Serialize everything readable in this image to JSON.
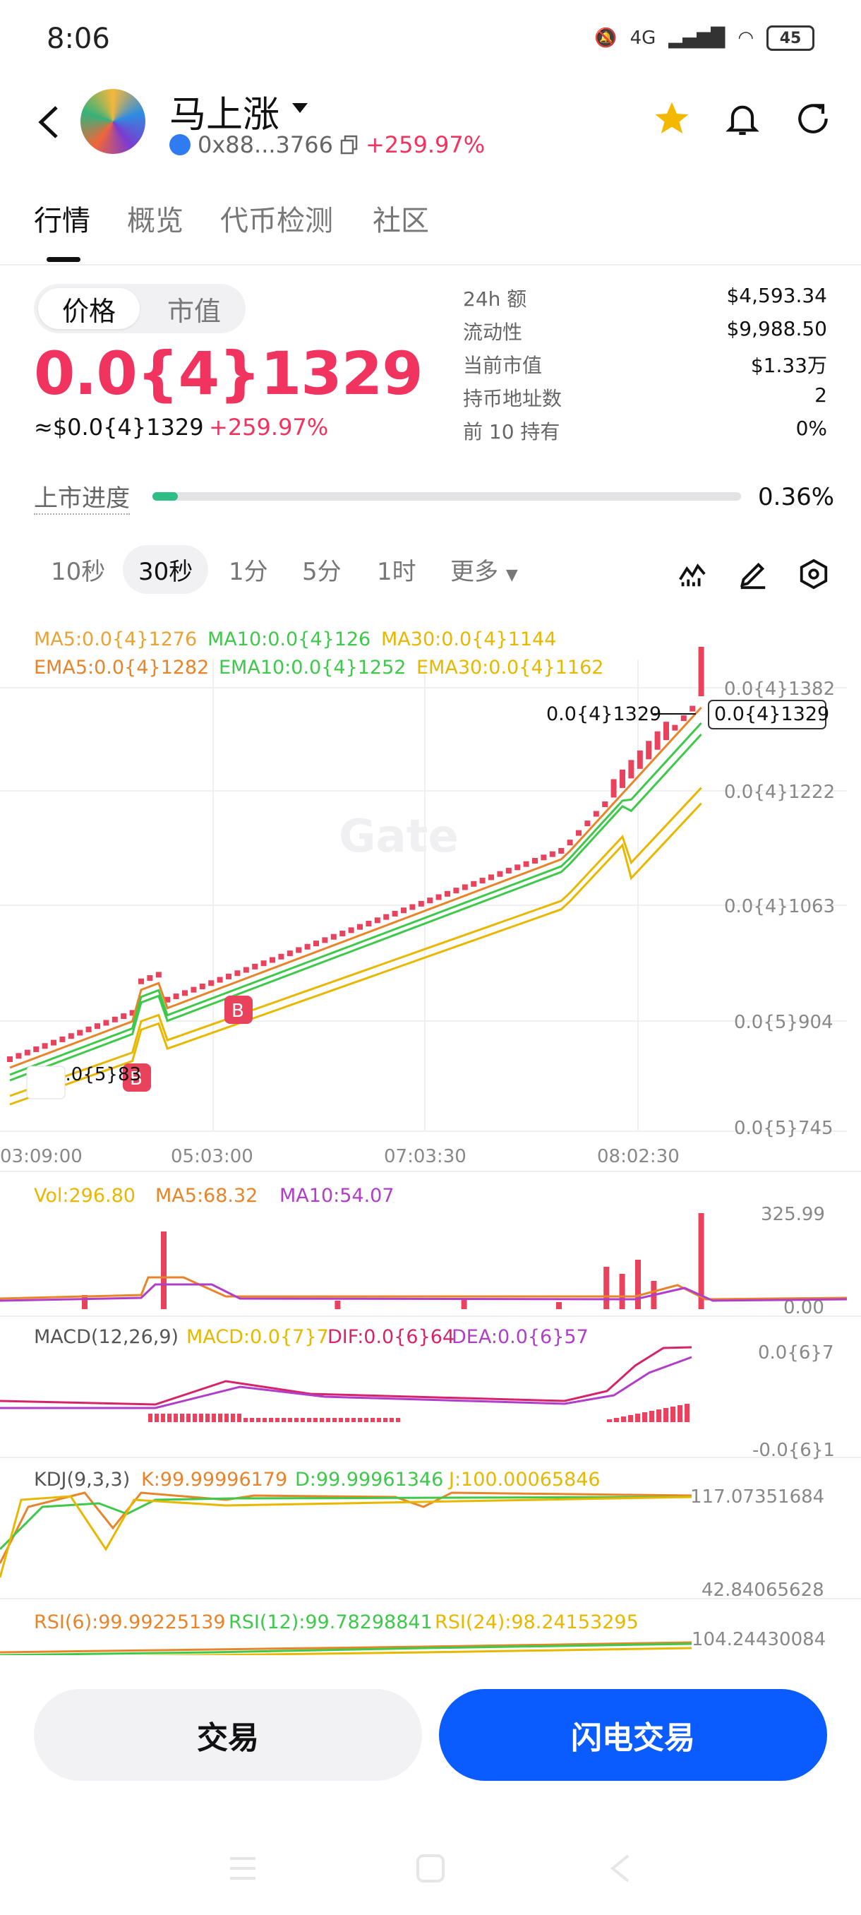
{
  "status": {
    "time": "8:06",
    "net": "4G",
    "battery": "45"
  },
  "header": {
    "name": "马上涨",
    "address": "0x88...3766",
    "change": "+259.97%"
  },
  "tabs": [
    "行情",
    "概览",
    "代币检测",
    "社区"
  ],
  "toggle": {
    "price": "价格",
    "mcap": "市值"
  },
  "price": {
    "main": "0.0{4}1329",
    "usd": "≈$0.0{4}1329",
    "change": "+259.97%"
  },
  "stats": [
    {
      "label": "24h 额",
      "value": "$4,593.34"
    },
    {
      "label": "流动性",
      "value": "$9,988.50"
    },
    {
      "label": "当前市值",
      "value": "$1.33万"
    },
    {
      "label": "持币地址数",
      "value": "2"
    },
    {
      "label": "前 10 持有",
      "value": "0%"
    }
  ],
  "listing": {
    "label": "上市进度",
    "value": "0.36%",
    "progress": 0.36
  },
  "intervals": [
    "10秒",
    "30秒",
    "1分",
    "5分",
    "1时",
    "更多"
  ],
  "active_interval": "30秒",
  "chart_data": [
    {
      "type": "line",
      "name": "candlestick",
      "ma": [
        "MA5:0.0{4}1276",
        "MA10:0.0{4}126",
        "MA30:0.0{4}1144"
      ],
      "ema": [
        "EMA5:0.0{4}1282",
        "EMA10:0.0{4}1252",
        "EMA30:0.0{4}1162"
      ],
      "y_ticks": [
        "0.0{4}1382",
        "0.0{4}1222",
        "0.0{4}1063",
        "0.0{5}904",
        "0.0{5}745"
      ],
      "x_ticks": [
        "03:09:00",
        "05:03:00",
        "07:03:30",
        "08:02:30"
      ],
      "last_price": "0.0{4}1329",
      "low_marker": "0.0{5}83",
      "buy_marker": "B",
      "watermark": "Gate"
    },
    {
      "type": "bar",
      "name": "volume",
      "labels": [
        "Vol:296.80",
        "MA5:68.32",
        "MA10:54.07"
      ],
      "y_ticks": [
        "325.99",
        "0.00"
      ]
    },
    {
      "type": "bar",
      "name": "macd",
      "labels": [
        "MACD(12,26,9)",
        "MACD:0.0{7}7",
        "DIF:0.0{6}64",
        "DEA:0.0{6}57"
      ],
      "y_ticks": [
        "0.0{6}7",
        "-0.0{6}1"
      ]
    },
    {
      "type": "line",
      "name": "kdj",
      "labels": [
        "KDJ(9,3,3)",
        "K:99.99996179",
        "D:99.99961346",
        "J:100.00065846"
      ],
      "y_ticks": [
        "117.07351684",
        "42.84065628"
      ]
    },
    {
      "type": "line",
      "name": "rsi",
      "labels": [
        "RSI(6):99.99225139",
        "RSI(12):99.78298841",
        "RSI(24):98.24153295"
      ],
      "y_ticks": [
        "104.24430084"
      ]
    }
  ],
  "buttons": {
    "trade": "交易",
    "flash": "闪电交易"
  }
}
